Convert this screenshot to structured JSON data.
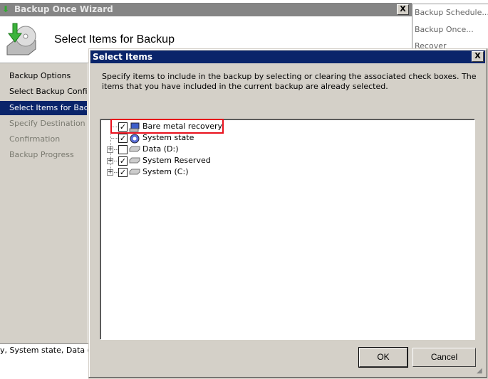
{
  "wizard": {
    "title": "Backup Once Wizard",
    "heading": "Select Items for Backup",
    "nav": [
      {
        "label": "Backup Options",
        "state": "done"
      },
      {
        "label": "Select Backup Configur",
        "state": "done"
      },
      {
        "label": "Select Items for Backup",
        "state": "selected"
      },
      {
        "label": "Specify Destination Typ",
        "state": "pending"
      },
      {
        "label": "Confirmation",
        "state": "pending"
      },
      {
        "label": "Backup Progress",
        "state": "pending"
      }
    ],
    "summary_text": "y, System state, Data (D:"
  },
  "actions": [
    "Backup Schedule...",
    "Backup Once...",
    "Recover"
  ],
  "dialog": {
    "title": "Select Items",
    "description": "Specify items to include in the backup by selecting or clearing the associated check boxes. The items that you have included in the current backup are already selected.",
    "tree": [
      {
        "label": "Bare metal recovery",
        "checked": true,
        "expandable": false,
        "icon": "computer-icon",
        "highlighted": true
      },
      {
        "label": "System state",
        "checked": true,
        "expandable": false,
        "icon": "gear-icon"
      },
      {
        "label": "Data (D:)",
        "checked": false,
        "expandable": true,
        "icon": "drive-icon"
      },
      {
        "label": "System Reserved",
        "checked": true,
        "expandable": true,
        "icon": "drive-icon"
      },
      {
        "label": "System (C:)",
        "checked": true,
        "expandable": true,
        "icon": "drive-icon"
      }
    ],
    "ok": "OK",
    "cancel": "Cancel",
    "close": "X"
  },
  "colors": {
    "titlebar_active": "#0a246a",
    "titlebar_inactive": "#858585",
    "highlight": "#e8101c"
  }
}
